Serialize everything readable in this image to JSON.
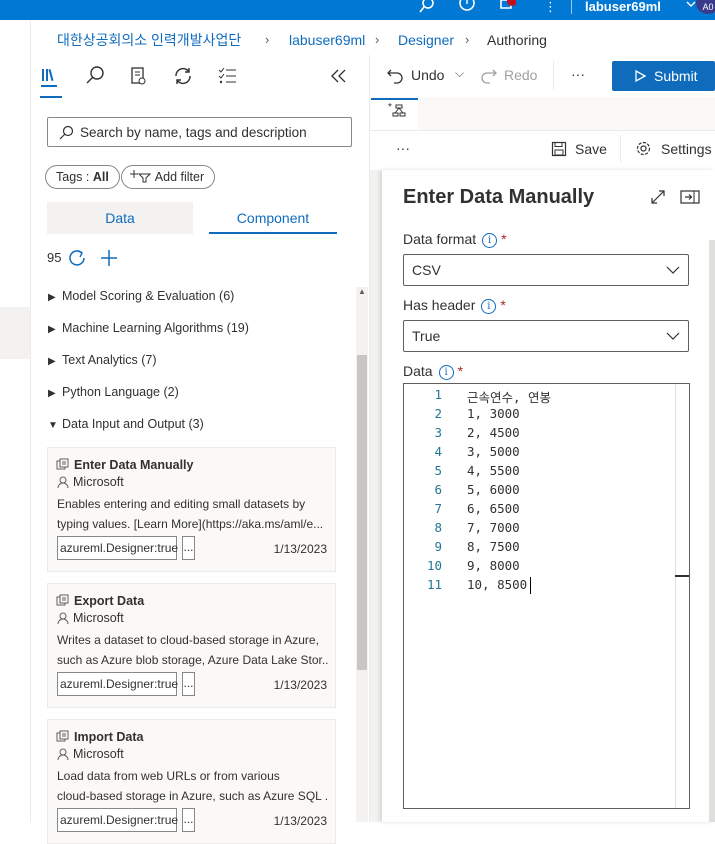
{
  "top_bar": {
    "user": "labuser69ml",
    "avatar_initials": "A0",
    "notification_badge": ""
  },
  "breadcrumb": {
    "workspace": "대한상공회의소 인력개발사업단",
    "user": "labuser69ml",
    "section": "Designer",
    "page": "Authoring"
  },
  "left_panel": {
    "search_placeholder": "Search by name, tags and description",
    "tags_label": "Tags : ",
    "tags_value": "All",
    "add_filter": "Add filter",
    "tabs": {
      "data": "Data",
      "component": "Component"
    },
    "count": "95",
    "categories": [
      {
        "label": "Model Scoring & Evaluation (6)",
        "expanded": false
      },
      {
        "label": "Machine Learning Algorithms (19)",
        "expanded": false
      },
      {
        "label": "Text Analytics (7)",
        "expanded": false
      },
      {
        "label": "Python Language (2)",
        "expanded": false
      },
      {
        "label": "Data Input and Output (3)",
        "expanded": true
      }
    ],
    "cards": [
      {
        "title": "Enter Data Manually",
        "publisher": "Microsoft",
        "desc_line1": "Enables entering and editing small datasets by",
        "desc_line2": "typing values. [Learn More](https://aka.ms/aml/e...",
        "tag": "azureml.Designer:true",
        "more": "...",
        "date": "1/13/2023"
      },
      {
        "title": "Export Data",
        "publisher": "Microsoft",
        "desc_line1": "Writes a dataset to cloud-based storage in Azure,",
        "desc_line2": "such as Azure blob storage, Azure Data Lake Stor...",
        "tag": "azureml.Designer:true",
        "more": "...",
        "date": "1/13/2023"
      },
      {
        "title": "Import Data",
        "publisher": "Microsoft",
        "desc_line1": "Load data from web URLs or from various",
        "desc_line2": "cloud-based storage in Azure, such as Azure SQL ...",
        "tag": "azureml.Designer:true",
        "more": "...",
        "date": "1/13/2023"
      }
    ]
  },
  "command_bar": {
    "undo": "Undo",
    "redo": "Redo",
    "more": "···",
    "submit": "Submit"
  },
  "doc_tab": {
    "label": "*"
  },
  "toolbar": {
    "more": "···",
    "save": "Save",
    "settings": "Settings"
  },
  "properties": {
    "title": "Enter Data Manually",
    "data_format_label": "Data format",
    "data_format_value": "CSV",
    "has_header_label": "Has header",
    "has_header_value": "True",
    "data_label": "Data",
    "required_mark": "*",
    "info_glyph": "i",
    "lines": [
      {
        "n": "1",
        "text": "근속연수, 연봉"
      },
      {
        "n": "2",
        "text": "1, 3000"
      },
      {
        "n": "3",
        "text": "2, 4500"
      },
      {
        "n": "4",
        "text": "3, 5000"
      },
      {
        "n": "5",
        "text": "4, 5500"
      },
      {
        "n": "6",
        "text": "5, 6000"
      },
      {
        "n": "7",
        "text": "6, 6500"
      },
      {
        "n": "8",
        "text": "7, 7000"
      },
      {
        "n": "9",
        "text": "8, 7500"
      },
      {
        "n": "10",
        "text": "9, 8000"
      },
      {
        "n": "11",
        "text": "10, 8500"
      }
    ]
  },
  "colors": {
    "accent": "#0f6cbd",
    "topbar": "#0078d4",
    "required": "#a4262c"
  }
}
